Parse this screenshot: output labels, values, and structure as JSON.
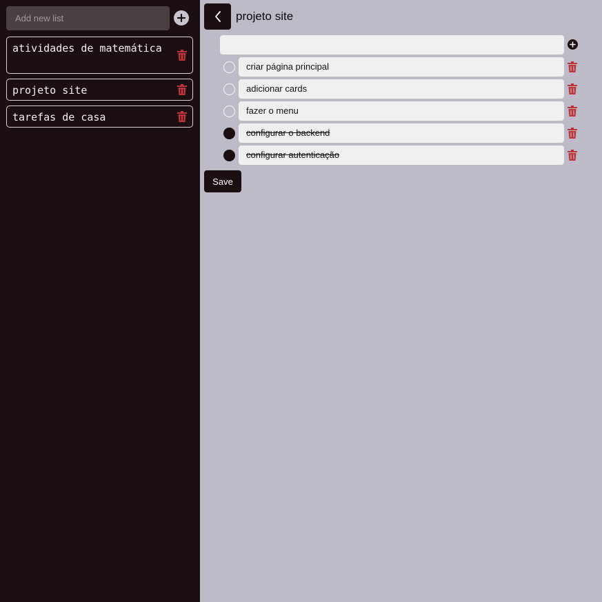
{
  "sidebar": {
    "new_list_placeholder": "Add new list",
    "lists": [
      {
        "label": "atividades de matemática"
      },
      {
        "label": "projeto site"
      },
      {
        "label": "tarefas de casa"
      }
    ]
  },
  "main": {
    "title": "projeto site",
    "new_task_value": "",
    "tasks": [
      {
        "label": "criar página principal",
        "done": false
      },
      {
        "label": "adicionar cards",
        "done": false
      },
      {
        "label": "fazer o menu",
        "done": false
      },
      {
        "label": "configurar o backend",
        "done": true
      },
      {
        "label": "configurar autenticação",
        "done": true
      }
    ],
    "save_label": "Save"
  },
  "colors": {
    "sidebar_bg": "#1b0f12",
    "main_bg": "#bebbc8",
    "trash": "#c0333a",
    "field_bg": "#f0f0f0"
  },
  "icons": {
    "add": "plus-circle-icon",
    "delete": "trash-icon",
    "back": "chevron-left-icon"
  }
}
